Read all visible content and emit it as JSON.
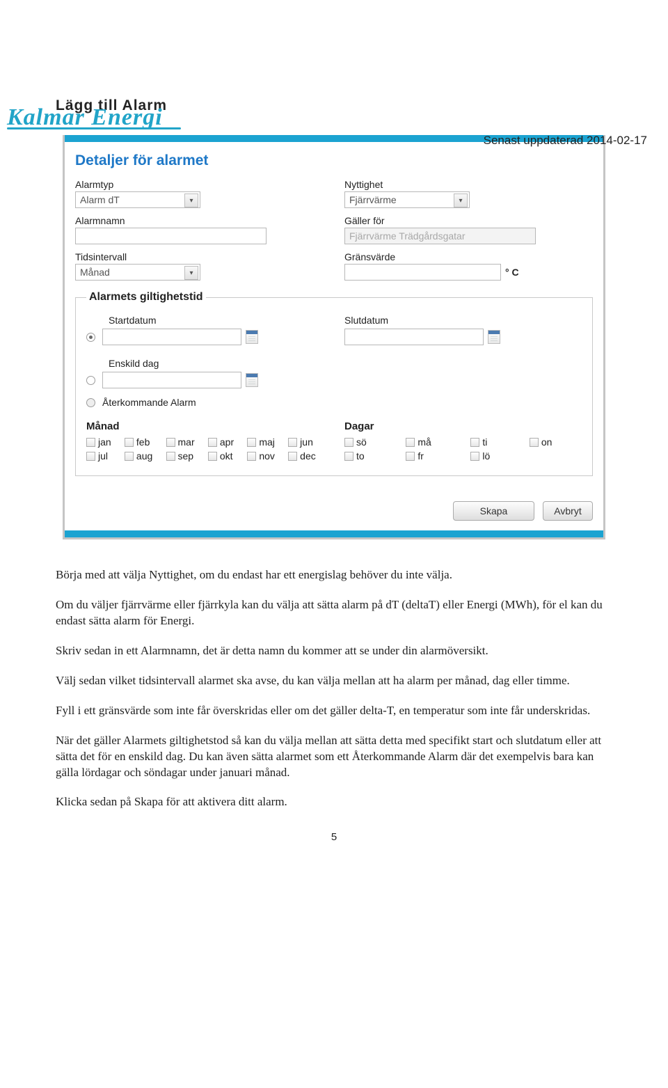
{
  "header": {
    "logo_text": "Kalmar Energi",
    "updated": "Senast uppdaterad 2014-02-17"
  },
  "section_title": "Lägg till Alarm",
  "panel": {
    "title": "Detaljer för alarmet",
    "alarmtyp_label": "Alarmtyp",
    "alarmtyp_value": "Alarm dT",
    "nyttighet_label": "Nyttighet",
    "nyttighet_value": "Fjärrvärme",
    "alarmnamn_label": "Alarmnamn",
    "alarmnamn_value": "",
    "galler_label": "Gäller för",
    "galler_value": "Fjärrvärme Trädgårdsgatar",
    "tidsintervall_label": "Tidsintervall",
    "tidsintervall_value": "Månad",
    "gransvarde_label": "Gränsvärde",
    "gransvarde_value": "",
    "gransvarde_unit": "° C",
    "validity": {
      "legend": "Alarmets giltighetstid",
      "start_label": "Startdatum",
      "slut_label": "Slutdatum",
      "enskild_label": "Enskild dag",
      "aterkommande_label": "Återkommande Alarm",
      "manad_label": "Månad",
      "months": [
        "jan",
        "feb",
        "mar",
        "apr",
        "maj",
        "jun",
        "jul",
        "aug",
        "sep",
        "okt",
        "nov",
        "dec"
      ],
      "dagar_label": "Dagar",
      "days": [
        "sö",
        "må",
        "ti",
        "on",
        "to",
        "fr",
        "lö"
      ]
    },
    "skapa": "Skapa",
    "avbryt": "Avbryt"
  },
  "body": {
    "p1": "Börja med att välja Nyttighet, om du endast har ett energislag behöver du inte välja.",
    "p2": "Om du väljer fjärrvärme eller fjärrkyla kan du välja att sätta alarm på dT (deltaT) eller Energi (MWh), för el kan du endast sätta alarm för Energi.",
    "p3": "Skriv sedan in ett Alarmnamn, det är detta namn du kommer att se under din alarmöversikt.",
    "p4": "Välj sedan vilket tidsintervall alarmet ska avse, du kan välja mellan att ha alarm per månad, dag eller timme.",
    "p5": "Fyll i ett gränsvärde som inte får överskridas eller om det gäller delta-T, en temperatur som inte får underskridas.",
    "p6": "När det gäller Alarmets giltighetstod så kan du välja mellan att sätta detta med specifikt start och slutdatum eller att sätta det för en enskild dag. Du kan även sätta alarmet som ett Återkommande Alarm där det exempelvis bara kan gälla lördagar och söndagar under januari månad.",
    "p7": "Klicka sedan på Skapa för att aktivera ditt alarm."
  },
  "page_number": "5"
}
